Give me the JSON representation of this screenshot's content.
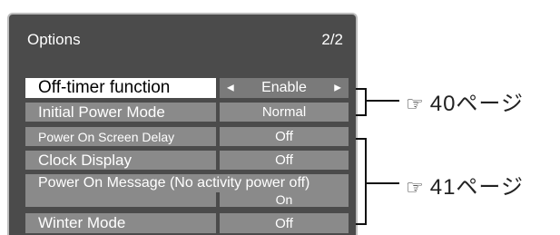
{
  "menu": {
    "title": "Options",
    "page": "2/2",
    "items": [
      {
        "label": "Off-timer function",
        "value": "Enable"
      },
      {
        "label": "Initial Power Mode",
        "value": "Normal"
      },
      {
        "label": "Power On Screen Delay",
        "value": "Off"
      },
      {
        "label": "Clock Display",
        "value": "Off"
      },
      {
        "label": "Power On Message (No activity power off)",
        "value": "On"
      },
      {
        "label": "Winter Mode",
        "value": "Off"
      }
    ]
  },
  "references": [
    {
      "icon": "☞",
      "text": "40ページ"
    },
    {
      "icon": "☞",
      "text": "41ページ"
    }
  ]
}
